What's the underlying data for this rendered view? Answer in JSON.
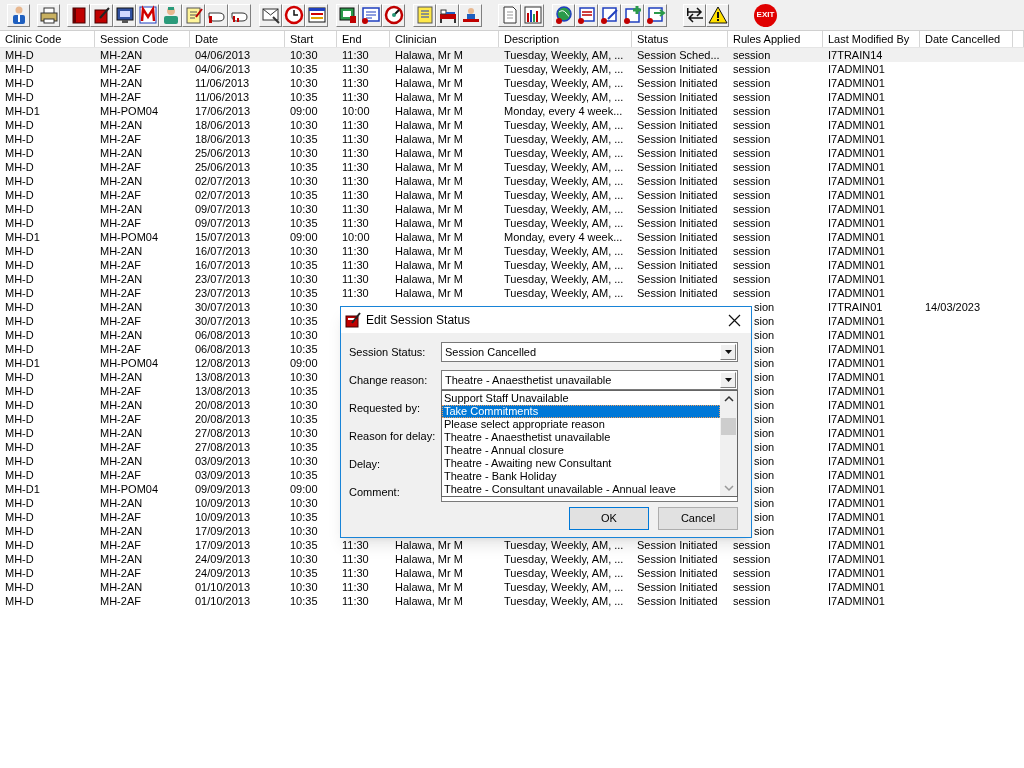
{
  "toolbar": {
    "exit_label": "EXIT"
  },
  "table": {
    "columns": [
      "Clinic Code",
      "Session Code",
      "Date",
      "Start",
      "End",
      "Clinician",
      "Description",
      "Status",
      "Rules Applied",
      "Last Modified By",
      "Date Cancelled"
    ],
    "rows": [
      {
        "clinic": "MH-D",
        "session": "MH-2AN",
        "date": "04/06/2013",
        "start": "10:30",
        "end": "11:30",
        "clinician": "Halawa, Mr M",
        "description": "Tuesday, Weekly, AM, ...",
        "status": "Session Sched...",
        "rules": "session",
        "modified_by": "I7TRAIN14",
        "selected": true,
        "covered": false
      },
      {
        "clinic": "MH-D",
        "session": "MH-2AF",
        "date": "04/06/2013",
        "start": "10:35",
        "end": "11:30",
        "clinician": "Halawa, Mr M",
        "description": "Tuesday, Weekly, AM, ...",
        "status": "Session Initiated",
        "rules": "session",
        "modified_by": "I7ADMIN01",
        "selected": false,
        "covered": false
      },
      {
        "clinic": "MH-D",
        "session": "MH-2AN",
        "date": "11/06/2013",
        "start": "10:30",
        "end": "11:30",
        "clinician": "Halawa, Mr M",
        "description": "Tuesday, Weekly, AM, ...",
        "status": "Session Initiated",
        "rules": "session",
        "modified_by": "I7ADMIN01",
        "selected": false,
        "covered": false
      },
      {
        "clinic": "MH-D",
        "session": "MH-2AF",
        "date": "11/06/2013",
        "start": "10:35",
        "end": "11:30",
        "clinician": "Halawa, Mr M",
        "description": "Tuesday, Weekly, AM, ...",
        "status": "Session Initiated",
        "rules": "session",
        "modified_by": "I7ADMIN01",
        "selected": false,
        "covered": false
      },
      {
        "clinic": "MH-D1",
        "session": "MH-POM04",
        "date": "17/06/2013",
        "start": "09:00",
        "end": "10:00",
        "clinician": "Halawa, Mr M",
        "description": "Monday, every 4 week...",
        "status": "Session Initiated",
        "rules": "session",
        "modified_by": "I7ADMIN01",
        "selected": false,
        "covered": false
      },
      {
        "clinic": "MH-D",
        "session": "MH-2AN",
        "date": "18/06/2013",
        "start": "10:30",
        "end": "11:30",
        "clinician": "Halawa, Mr M",
        "description": "Tuesday, Weekly, AM, ...",
        "status": "Session Initiated",
        "rules": "session",
        "modified_by": "I7ADMIN01",
        "selected": false,
        "covered": false
      },
      {
        "clinic": "MH-D",
        "session": "MH-2AF",
        "date": "18/06/2013",
        "start": "10:35",
        "end": "11:30",
        "clinician": "Halawa, Mr M",
        "description": "Tuesday, Weekly, AM, ...",
        "status": "Session Initiated",
        "rules": "session",
        "modified_by": "I7ADMIN01",
        "selected": false,
        "covered": false
      },
      {
        "clinic": "MH-D",
        "session": "MH-2AN",
        "date": "25/06/2013",
        "start": "10:30",
        "end": "11:30",
        "clinician": "Halawa, Mr M",
        "description": "Tuesday, Weekly, AM, ...",
        "status": "Session Initiated",
        "rules": "session",
        "modified_by": "I7ADMIN01",
        "selected": false,
        "covered": false
      },
      {
        "clinic": "MH-D",
        "session": "MH-2AF",
        "date": "25/06/2013",
        "start": "10:35",
        "end": "11:30",
        "clinician": "Halawa, Mr M",
        "description": "Tuesday, Weekly, AM, ...",
        "status": "Session Initiated",
        "rules": "session",
        "modified_by": "I7ADMIN01",
        "selected": false,
        "covered": false
      },
      {
        "clinic": "MH-D",
        "session": "MH-2AN",
        "date": "02/07/2013",
        "start": "10:30",
        "end": "11:30",
        "clinician": "Halawa, Mr M",
        "description": "Tuesday, Weekly, AM, ...",
        "status": "Session Initiated",
        "rules": "session",
        "modified_by": "I7ADMIN01",
        "selected": false,
        "covered": false
      },
      {
        "clinic": "MH-D",
        "session": "MH-2AF",
        "date": "02/07/2013",
        "start": "10:35",
        "end": "11:30",
        "clinician": "Halawa, Mr M",
        "description": "Tuesday, Weekly, AM, ...",
        "status": "Session Initiated",
        "rules": "session",
        "modified_by": "I7ADMIN01",
        "selected": false,
        "covered": false
      },
      {
        "clinic": "MH-D",
        "session": "MH-2AN",
        "date": "09/07/2013",
        "start": "10:30",
        "end": "11:30",
        "clinician": "Halawa, Mr M",
        "description": "Tuesday, Weekly, AM, ...",
        "status": "Session Initiated",
        "rules": "session",
        "modified_by": "I7ADMIN01",
        "selected": false,
        "covered": false
      },
      {
        "clinic": "MH-D",
        "session": "MH-2AF",
        "date": "09/07/2013",
        "start": "10:35",
        "end": "11:30",
        "clinician": "Halawa, Mr M",
        "description": "Tuesday, Weekly, AM, ...",
        "status": "Session Initiated",
        "rules": "session",
        "modified_by": "I7ADMIN01",
        "selected": false,
        "covered": false
      },
      {
        "clinic": "MH-D1",
        "session": "MH-POM04",
        "date": "15/07/2013",
        "start": "09:00",
        "end": "10:00",
        "clinician": "Halawa, Mr M",
        "description": "Monday, every 4 week...",
        "status": "Session Initiated",
        "rules": "session",
        "modified_by": "I7ADMIN01",
        "selected": false,
        "covered": false
      },
      {
        "clinic": "MH-D",
        "session": "MH-2AN",
        "date": "16/07/2013",
        "start": "10:30",
        "end": "11:30",
        "clinician": "Halawa, Mr M",
        "description": "Tuesday, Weekly, AM, ...",
        "status": "Session Initiated",
        "rules": "session",
        "modified_by": "I7ADMIN01",
        "selected": false,
        "covered": false
      },
      {
        "clinic": "MH-D",
        "session": "MH-2AF",
        "date": "16/07/2013",
        "start": "10:35",
        "end": "11:30",
        "clinician": "Halawa, Mr M",
        "description": "Tuesday, Weekly, AM, ...",
        "status": "Session Initiated",
        "rules": "session",
        "modified_by": "I7ADMIN01",
        "selected": false,
        "covered": false
      },
      {
        "clinic": "MH-D",
        "session": "MH-2AN",
        "date": "23/07/2013",
        "start": "10:30",
        "end": "11:30",
        "clinician": "Halawa, Mr M",
        "description": "Tuesday, Weekly, AM, ...",
        "status": "Session Initiated",
        "rules": "session",
        "modified_by": "I7ADMIN01",
        "selected": false,
        "covered": false
      },
      {
        "clinic": "MH-D",
        "session": "MH-2AF",
        "date": "23/07/2013",
        "start": "10:35",
        "end": "11:30",
        "clinician": "Halawa, Mr M",
        "description": "Tuesday, Weekly, AM, ...",
        "status": "Session Initiated",
        "rules": "session",
        "modified_by": "I7ADMIN01",
        "selected": false,
        "covered": false
      },
      {
        "clinic": "MH-D",
        "session": "MH-2AN",
        "date": "30/07/2013",
        "start": "10:30",
        "rules": "sion",
        "modified_by": "I7TRAIN01",
        "date_cancelled": "14/03/2023",
        "selected": false,
        "covered": true
      },
      {
        "clinic": "MH-D",
        "session": "MH-2AF",
        "date": "30/07/2013",
        "start": "10:35",
        "rules": "sion",
        "modified_by": "I7ADMIN01",
        "selected": false,
        "covered": true
      },
      {
        "clinic": "MH-D",
        "session": "MH-2AN",
        "date": "06/08/2013",
        "start": "10:30",
        "rules": "sion",
        "modified_by": "I7ADMIN01",
        "selected": false,
        "covered": true
      },
      {
        "clinic": "MH-D",
        "session": "MH-2AF",
        "date": "06/08/2013",
        "start": "10:35",
        "rules": "sion",
        "modified_by": "I7ADMIN01",
        "selected": false,
        "covered": true
      },
      {
        "clinic": "MH-D1",
        "session": "MH-POM04",
        "date": "12/08/2013",
        "start": "09:00",
        "rules": "sion",
        "modified_by": "I7ADMIN01",
        "selected": false,
        "covered": true
      },
      {
        "clinic": "MH-D",
        "session": "MH-2AN",
        "date": "13/08/2013",
        "start": "10:30",
        "rules": "sion",
        "modified_by": "I7ADMIN01",
        "selected": false,
        "covered": true
      },
      {
        "clinic": "MH-D",
        "session": "MH-2AF",
        "date": "13/08/2013",
        "start": "10:35",
        "rules": "sion",
        "modified_by": "I7ADMIN01",
        "selected": false,
        "covered": true
      },
      {
        "clinic": "MH-D",
        "session": "MH-2AN",
        "date": "20/08/2013",
        "start": "10:30",
        "rules": "sion",
        "modified_by": "I7ADMIN01",
        "selected": false,
        "covered": true
      },
      {
        "clinic": "MH-D",
        "session": "MH-2AF",
        "date": "20/08/2013",
        "start": "10:35",
        "rules": "sion",
        "modified_by": "I7ADMIN01",
        "selected": false,
        "covered": true
      },
      {
        "clinic": "MH-D",
        "session": "MH-2AN",
        "date": "27/08/2013",
        "start": "10:30",
        "rules": "sion",
        "modified_by": "I7ADMIN01",
        "selected": false,
        "covered": true
      },
      {
        "clinic": "MH-D",
        "session": "MH-2AF",
        "date": "27/08/2013",
        "start": "10:35",
        "rules": "sion",
        "modified_by": "I7ADMIN01",
        "selected": false,
        "covered": true
      },
      {
        "clinic": "MH-D",
        "session": "MH-2AN",
        "date": "03/09/2013",
        "start": "10:30",
        "rules": "sion",
        "modified_by": "I7ADMIN01",
        "selected": false,
        "covered": true
      },
      {
        "clinic": "MH-D",
        "session": "MH-2AF",
        "date": "03/09/2013",
        "start": "10:35",
        "rules": "sion",
        "modified_by": "I7ADMIN01",
        "selected": false,
        "covered": true
      },
      {
        "clinic": "MH-D1",
        "session": "MH-POM04",
        "date": "09/09/2013",
        "start": "09:00",
        "rules": "sion",
        "modified_by": "I7ADMIN01",
        "selected": false,
        "covered": true
      },
      {
        "clinic": "MH-D",
        "session": "MH-2AN",
        "date": "10/09/2013",
        "start": "10:30",
        "rules": "sion",
        "modified_by": "I7ADMIN01",
        "selected": false,
        "covered": true
      },
      {
        "clinic": "MH-D",
        "session": "MH-2AF",
        "date": "10/09/2013",
        "start": "10:35",
        "rules": "sion",
        "modified_by": "I7ADMIN01",
        "selected": false,
        "covered": true
      },
      {
        "clinic": "MH-D",
        "session": "MH-2AN",
        "date": "17/09/2013",
        "start": "10:30",
        "rules": "sion",
        "modified_by": "I7ADMIN01",
        "selected": false,
        "covered": true
      },
      {
        "clinic": "MH-D",
        "session": "MH-2AF",
        "date": "17/09/2013",
        "start": "10:35",
        "end": "11:30",
        "clinician": "Halawa, Mr M",
        "description": "Tuesday, Weekly, AM, ...",
        "status": "Session Initiated",
        "rules": "session",
        "modified_by": "I7ADMIN01",
        "selected": false,
        "covered": false
      },
      {
        "clinic": "MH-D",
        "session": "MH-2AN",
        "date": "24/09/2013",
        "start": "10:30",
        "end": "11:30",
        "clinician": "Halawa, Mr M",
        "description": "Tuesday, Weekly, AM, ...",
        "status": "Session Initiated",
        "rules": "session",
        "modified_by": "I7ADMIN01",
        "selected": false,
        "covered": false
      },
      {
        "clinic": "MH-D",
        "session": "MH-2AF",
        "date": "24/09/2013",
        "start": "10:35",
        "end": "11:30",
        "clinician": "Halawa, Mr M",
        "description": "Tuesday, Weekly, AM, ...",
        "status": "Session Initiated",
        "rules": "session",
        "modified_by": "I7ADMIN01",
        "selected": false,
        "covered": false
      },
      {
        "clinic": "MH-D",
        "session": "MH-2AN",
        "date": "01/10/2013",
        "start": "10:30",
        "end": "11:30",
        "clinician": "Halawa, Mr M",
        "description": "Tuesday, Weekly, AM, ...",
        "status": "Session Initiated",
        "rules": "session",
        "modified_by": "I7ADMIN01",
        "selected": false,
        "covered": false
      },
      {
        "clinic": "MH-D",
        "session": "MH-2AF",
        "date": "01/10/2013",
        "start": "10:35",
        "end": "11:30",
        "clinician": "Halawa, Mr M",
        "description": "Tuesday, Weekly, AM, ...",
        "status": "Session Initiated",
        "rules": "session",
        "modified_by": "I7ADMIN01",
        "selected": false,
        "covered": false
      }
    ]
  },
  "dialog": {
    "title": "Edit Session Status",
    "session_status": {
      "label": "Session Status:",
      "value": "Session Cancelled"
    },
    "change_reason": {
      "label": "Change reason:",
      "value": "Theatre - Anaesthetist unavailable"
    },
    "labels": [
      "Requested by:",
      "Reason for delay:",
      "Delay:",
      "Comment:"
    ],
    "dropdown": {
      "items": [
        {
          "label": "Support Staff Unavailable",
          "selected": false
        },
        {
          "label": "Take Commitments",
          "selected": true
        },
        {
          "label": "Please select appropriate reason",
          "selected": false
        },
        {
          "label": "Theatre - Anaesthetist unavailable",
          "selected": false
        },
        {
          "label": "Theatre - Annual closure",
          "selected": false
        },
        {
          "label": "Theatre - Awaiting new Consultant",
          "selected": false
        },
        {
          "label": "Theatre - Bank Holiday",
          "selected": false
        },
        {
          "label": "Theatre - Consultant unavailable - Annual leave",
          "selected": false
        }
      ]
    },
    "buttons": [
      "OK",
      "Cancel"
    ]
  }
}
